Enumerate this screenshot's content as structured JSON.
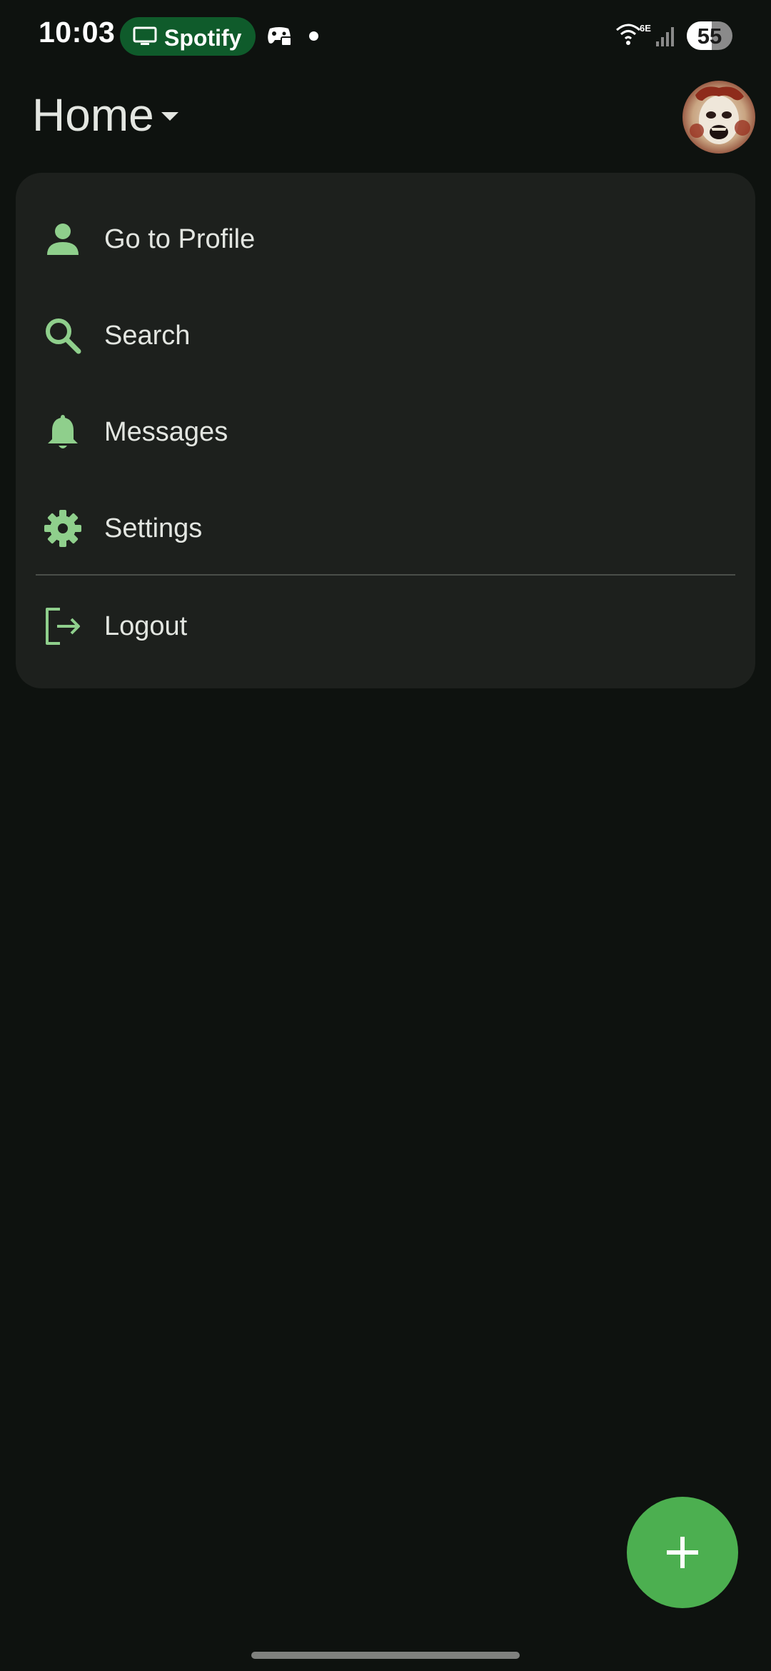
{
  "status_bar": {
    "time": "10:03",
    "cast_chip_label": "Spotify",
    "cast_icon": "cast-screen-icon",
    "app_icon": "game-controller-icon",
    "wifi_icon": "wifi-6e-icon",
    "wifi_badge": "6E",
    "signal_icon": "cellular-signal-icon",
    "battery_level": "55",
    "battery_fraction": 0.55
  },
  "header": {
    "title": "Home",
    "dropdown_icon": "arrow-drop-down-icon",
    "avatar_icon": "profile-avatar"
  },
  "menu": {
    "items": [
      {
        "label": "Go to Profile",
        "icon": "person-icon"
      },
      {
        "label": "Search",
        "icon": "search-icon"
      },
      {
        "label": "Messages",
        "icon": "bell-icon"
      },
      {
        "label": "Settings",
        "icon": "gear-icon"
      },
      {
        "label": "Logout",
        "icon": "logout-icon"
      }
    ]
  },
  "fab": {
    "icon": "plus-icon"
  },
  "colors": {
    "background": "#0e120f",
    "card": "#1d201d",
    "accent_icon": "#8fcf8c",
    "fab": "#4caf50",
    "chip": "#0f5b2b"
  }
}
